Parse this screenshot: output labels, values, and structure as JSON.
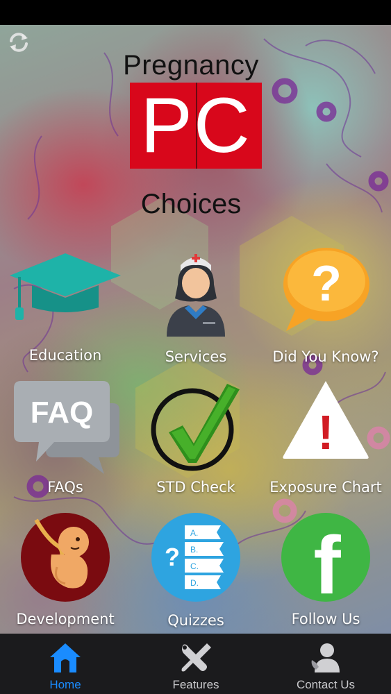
{
  "header": {
    "logo_top": "Pregnancy",
    "logo_letters": "PC",
    "logo_bottom": "Choices"
  },
  "tiles": [
    {
      "label": "Education",
      "icon": "graduation-cap-icon"
    },
    {
      "label": "Services",
      "icon": "nurse-icon"
    },
    {
      "label": "Did You Know?",
      "icon": "question-bubble-icon"
    },
    {
      "label": "FAQs",
      "icon": "faq-bubbles-icon"
    },
    {
      "label": "STD Check",
      "icon": "checkmark-circle-icon"
    },
    {
      "label": "Exposure Chart",
      "icon": "warning-triangle-icon"
    },
    {
      "label": "Development",
      "icon": "fetus-icon"
    },
    {
      "label": "Quizzes",
      "icon": "quiz-list-icon"
    },
    {
      "label": "Follow Us",
      "icon": "facebook-icon"
    }
  ],
  "icon_text": {
    "faq": "FAQ",
    "question": "?",
    "warning": "!",
    "facebook": "f",
    "quiz_options": [
      "A.",
      "B.",
      "C.",
      "D."
    ]
  },
  "tabbar": {
    "items": [
      {
        "label": "Home",
        "icon": "home-icon",
        "active": true
      },
      {
        "label": "Features",
        "icon": "tools-icon",
        "active": false
      },
      {
        "label": "Contact Us",
        "icon": "contact-person-icon",
        "active": false
      }
    ]
  },
  "colors": {
    "logo_red": "#d8071b",
    "tab_active": "#1a8cff",
    "tab_bar": "#1b1b1d"
  }
}
